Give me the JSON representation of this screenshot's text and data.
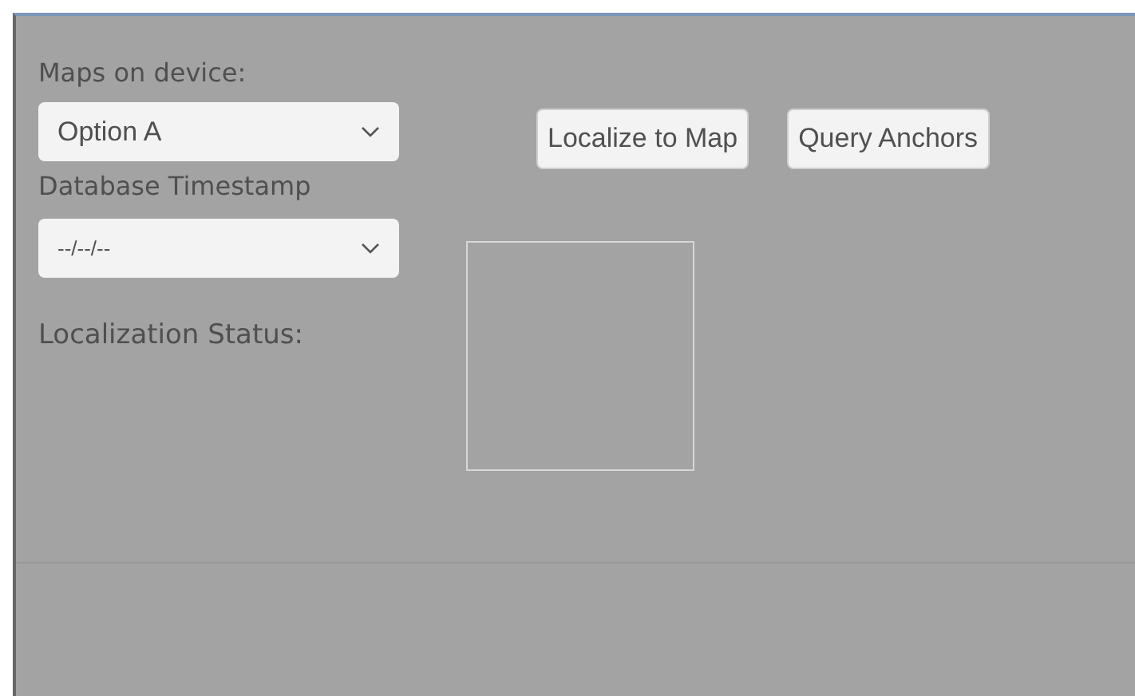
{
  "maps_label": "Maps on device:",
  "maps_dropdown": {
    "value": "Option A"
  },
  "buttons": [
    "Localize to Map",
    "Query Anchors"
  ],
  "timestamp_label": "Database Timestamp",
  "timestamp_dropdown": {
    "value": "--/--/--"
  },
  "status_label": "Localization Status:"
}
